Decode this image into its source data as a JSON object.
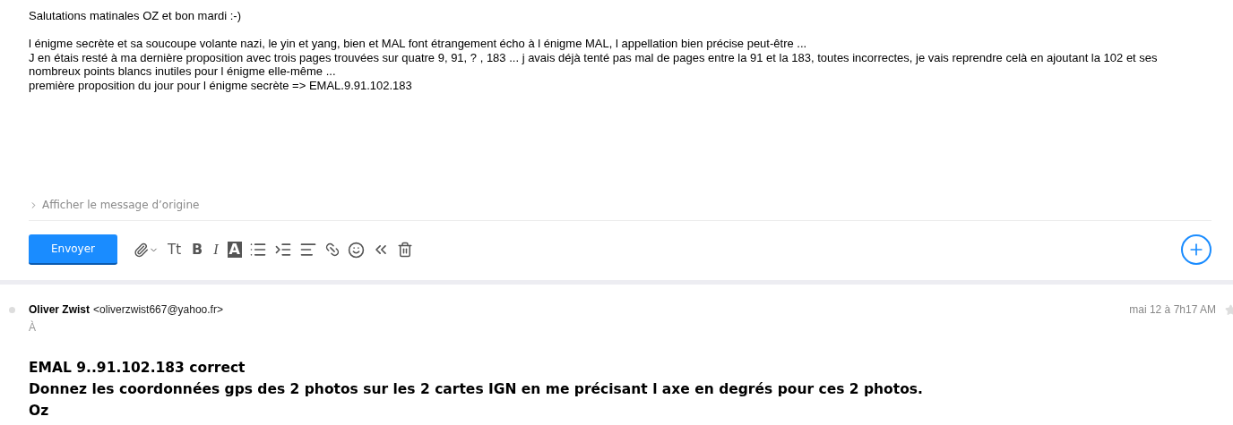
{
  "reply_draft": {
    "greeting": "Salutations matinales OZ et bon mardi :-)",
    "lines": [
      "l énigme secrète et sa soucoupe volante nazi, le yin et yang, bien et MAL font étrangement écho à l énigme MAL, l appellation bien précise peut-être ...",
      "J en étais resté à ma dernière proposition avec trois pages trouvées sur quatre 9, 91, ? , 183 ... j avais déjà tenté pas mal de pages entre la 91 et la 183, toutes incorrectes, je vais reprendre celà  en ajoutant la 102 et ses nombreux points blancs inutiles pour l énigme elle-même ...",
      "première proposition du jour pour l énigme secrète => EMAL.9.91.102.183"
    ],
    "show_original": {
      "label": "Afficher le message d’origine",
      "expanded": false
    }
  },
  "toolbar": {
    "send_label": "Envoyer",
    "text_tools": [
      "Tt",
      "B",
      "I",
      "A"
    ]
  },
  "message": {
    "sender_name": "Oliver Zwist",
    "sender_email": "<oliverzwist667@yahoo.fr>",
    "to_label": "À",
    "date": "mai 12 à 7h17 AM",
    "unread": false,
    "starred": false,
    "body": [
      "EMAL 9..91.102.183 correct",
      "Donnez les coordonnées gps des 2 photos sur les 2 cartes IGN en me précisant l axe en degrés pour ces 2 photos.",
      "Oz"
    ]
  }
}
